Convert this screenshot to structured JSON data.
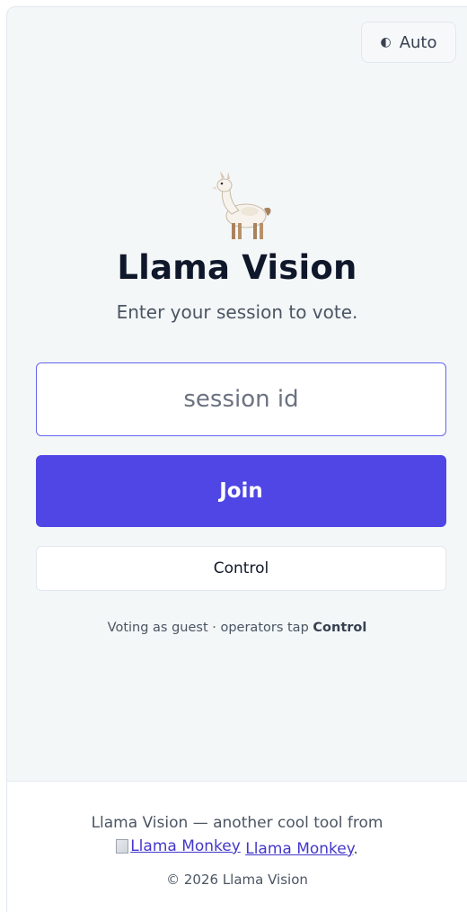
{
  "header": {
    "theme_toggle": {
      "icon": "half-circle-contrast-icon",
      "label": "Auto"
    }
  },
  "hero": {
    "logo_icon": "llama-icon",
    "title": "Llama Vision",
    "subtitle": "Enter your session to vote."
  },
  "form": {
    "session_input": {
      "placeholder": "session id",
      "value": ""
    },
    "join_label": "Join",
    "control_label": "Control",
    "note_prefix": "Voting as guest · operators tap ",
    "note_strong": "Control"
  },
  "footer": {
    "line1": "Llama Vision — another cool tool from",
    "broken_image_alt": "Llama Monkey",
    "link_text": "Llama Monkey",
    "link_suffix": ".",
    "copyright": "© 2026 Llama Vision"
  },
  "colors": {
    "accent": "#4f46e5",
    "input_border": "#6366f1",
    "page_bg": "#f4f7f8",
    "title": "#0f172a"
  }
}
